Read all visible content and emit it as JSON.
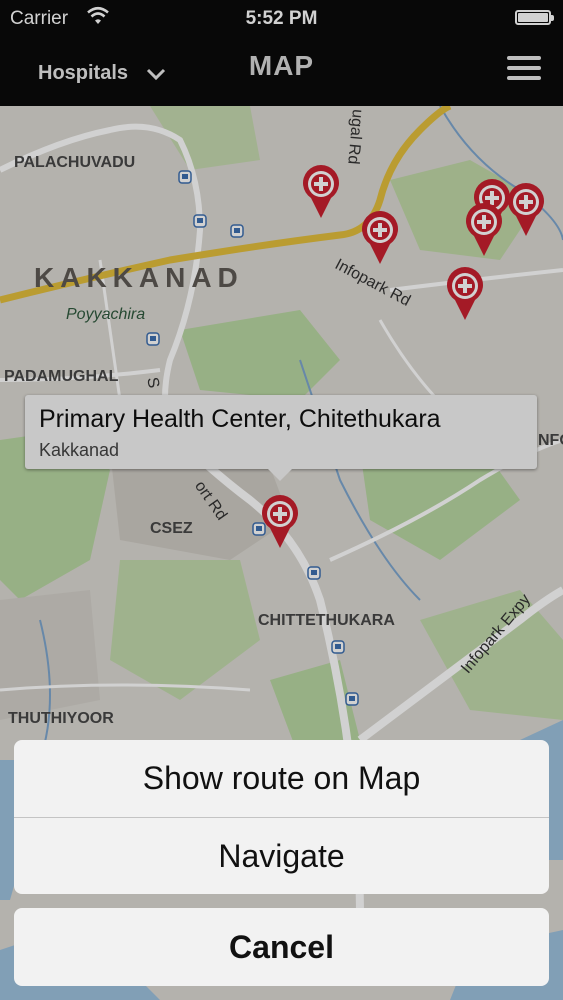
{
  "status_bar": {
    "carrier": "Carrier",
    "time": "5:52 PM"
  },
  "nav": {
    "filter_label": "Hospitals",
    "title": "MAP"
  },
  "map": {
    "labels": {
      "palachuvadu": "PALACHUVADU",
      "kakkanad": "KAKKANAD",
      "poyyachira": "Poyyachira",
      "padamughal": "PADAMUGHAL",
      "csez": "CSEZ",
      "chittethukara": "CHITTETHUKARA",
      "thuthiyoor": "THUTHIYOOR",
      "nfo": "NFO"
    },
    "roads": {
      "infopark_rd": "Infopark Rd",
      "infopark_expy": "Infopark Expy",
      "airport_rd_fragment": "ort Rd",
      "s_fragment": "S",
      "chugal_rd_fragment": "ugal Rd"
    }
  },
  "callout": {
    "name": "Primary Health Center, Chitethukara",
    "location": "Kakkanad"
  },
  "action_sheet": {
    "options": [
      "Show route on Map",
      "Navigate"
    ],
    "cancel": "Cancel"
  },
  "colors": {
    "pin": "#c8202f",
    "navbar": "#0a0a0a",
    "road_major": "#e3bf3c",
    "park": "#b9d7a3"
  }
}
